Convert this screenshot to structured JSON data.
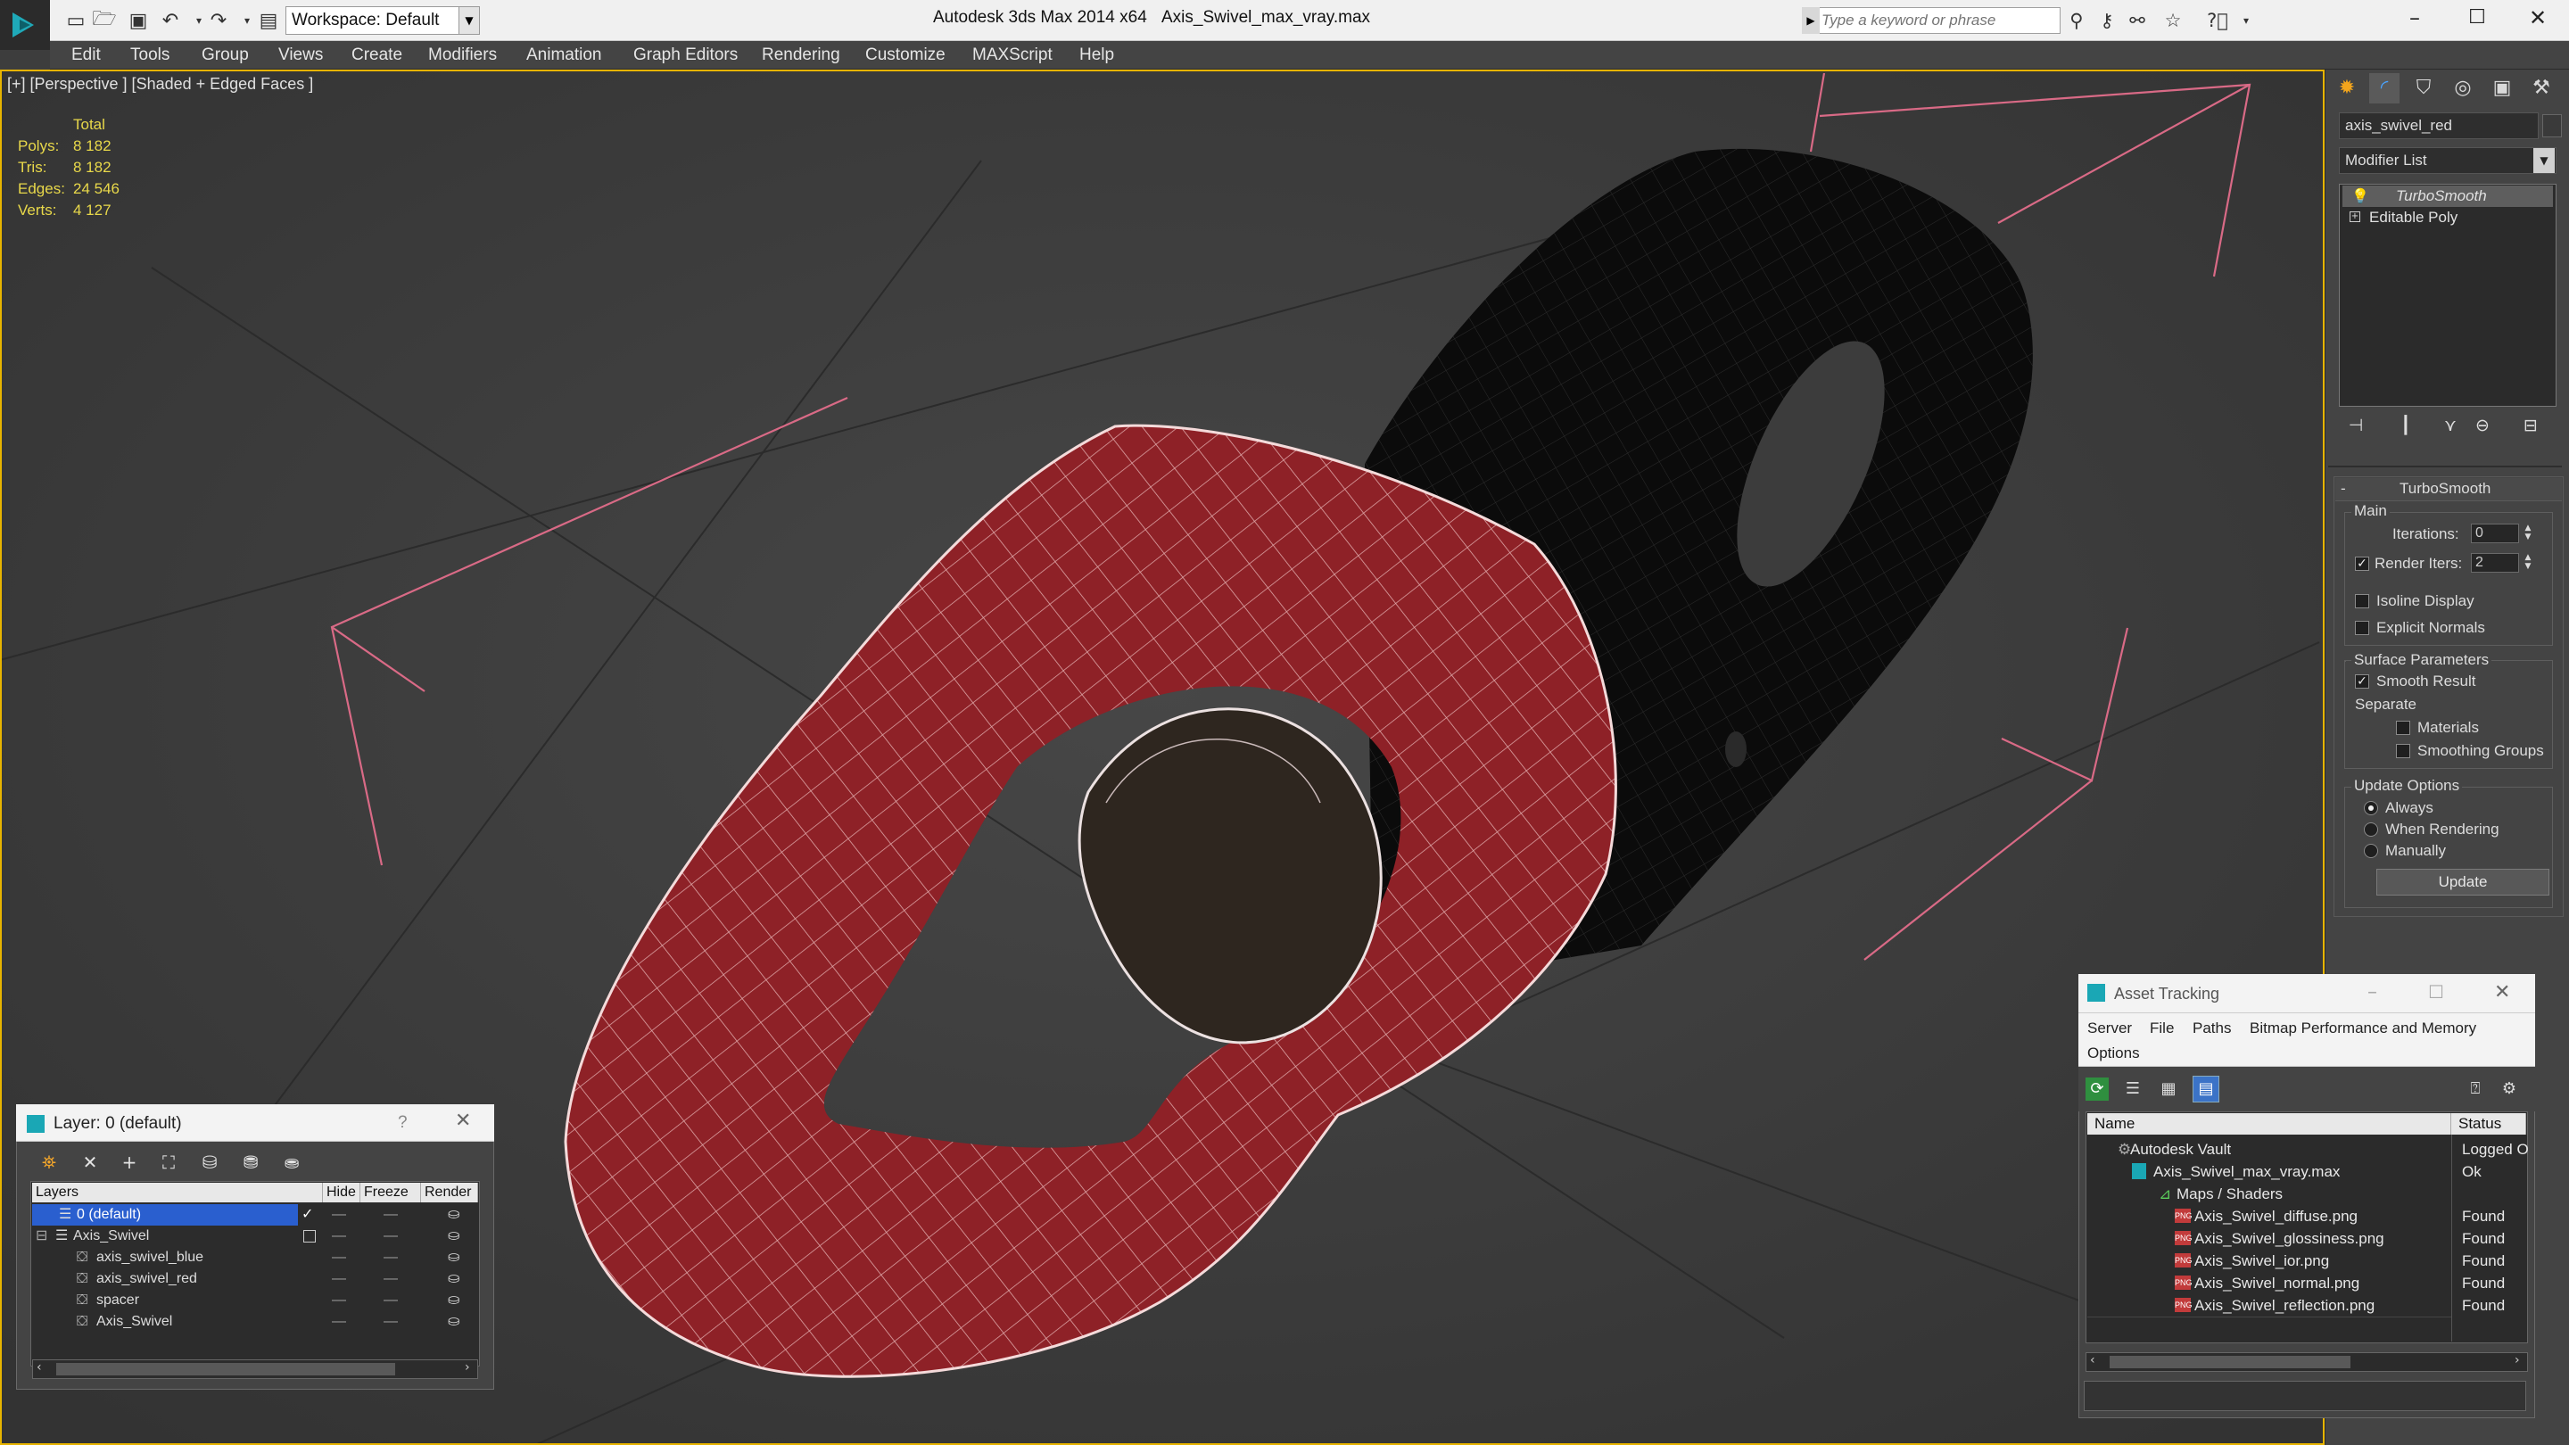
{
  "app": {
    "title": "Autodesk 3ds Max  2014 x64",
    "file": "Axis_Swivel_max_vray.max",
    "workspace": "Workspace: Default",
    "search_placeholder": "Type a keyword or phrase"
  },
  "menu": [
    "Edit",
    "Tools",
    "Group",
    "Views",
    "Create",
    "Modifiers",
    "Animation",
    "Graph Editors",
    "Rendering",
    "Customize",
    "MAXScript",
    "Help"
  ],
  "viewport": {
    "label": "[+] [Perspective ] [Shaded + Edged Faces ]",
    "stats": {
      "total_label": "Total",
      "rows": [
        {
          "label": "Polys:",
          "value": "8 182"
        },
        {
          "label": "Tris:",
          "value": "8 182"
        },
        {
          "label": "Edges:",
          "value": "24 546"
        },
        {
          "label": "Verts:",
          "value": "4 127"
        }
      ]
    }
  },
  "command_panel": {
    "object_name": "axis_swivel_red",
    "modifier_list": "Modifier List",
    "stack": [
      "TurboSmooth",
      "Editable Poly"
    ],
    "turbosmooth": {
      "title": "TurboSmooth",
      "main": "Main",
      "iterations_label": "Iterations:",
      "iterations": "0",
      "render_iters_label": "Render Iters:",
      "render_iters": "2",
      "isoline": "Isoline Display",
      "explicit_normals": "Explicit Normals",
      "surface_params": "Surface Parameters",
      "smooth_result": "Smooth Result",
      "separate": "Separate",
      "materials": "Materials",
      "smoothing_groups": "Smoothing Groups",
      "update_options": "Update Options",
      "always": "Always",
      "when_rendering": "When Rendering",
      "manually": "Manually",
      "update": "Update"
    }
  },
  "layer_dialog": {
    "title": "Layer: 0 (default)",
    "help": "?",
    "columns": [
      "Layers",
      "Hide",
      "Freeze",
      "Render"
    ],
    "rows": [
      {
        "name": "0 (default)",
        "dots_hide": "—",
        "dots_freeze": "—"
      },
      {
        "name": "Axis_Swivel",
        "dots_hide": "—",
        "dots_freeze": "—"
      },
      {
        "name": "axis_swivel_blue",
        "dots_hide": "—",
        "dots_freeze": "—"
      },
      {
        "name": "axis_swivel_red",
        "dots_hide": "—",
        "dots_freeze": "—"
      },
      {
        "name": "spacer",
        "dots_hide": "—",
        "dots_freeze": "—"
      },
      {
        "name": "Axis_Swivel",
        "dots_hide": "—",
        "dots_freeze": "—"
      }
    ]
  },
  "asset_tracking": {
    "title": "Asset Tracking",
    "menu": [
      "Server",
      "File",
      "Paths",
      "Bitmap Performance and Memory",
      "Options"
    ],
    "columns": [
      "Name",
      "Status"
    ],
    "rows": [
      {
        "name": "Autodesk Vault",
        "status": "Logged O"
      },
      {
        "name": "Axis_Swivel_max_vray.max",
        "status": "Ok"
      },
      {
        "name": "Maps / Shaders",
        "status": ""
      },
      {
        "name": "Axis_Swivel_diffuse.png",
        "status": "Found"
      },
      {
        "name": "Axis_Swivel_glossiness.png",
        "status": "Found"
      },
      {
        "name": "Axis_Swivel_ior.png",
        "status": "Found"
      },
      {
        "name": "Axis_Swivel_normal.png",
        "status": "Found"
      },
      {
        "name": "Axis_Swivel_reflection.png",
        "status": "Found"
      }
    ]
  },
  "colors": {
    "viewport_border": "#e7b400",
    "mesh_red": "#8e2127",
    "mesh_black": "#0b0b0b",
    "stats_yellow": "#e8d84a",
    "selection_blue": "#2a5fcf"
  }
}
